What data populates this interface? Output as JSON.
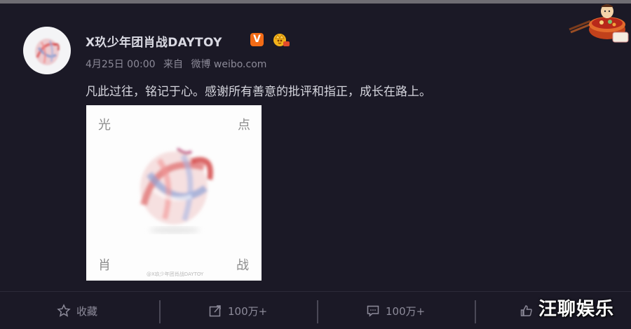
{
  "post": {
    "username": "X玖少年团肖战DAYTOY",
    "verified_badge": "V",
    "date": "4月25日 00:00",
    "source_prefix": "来自",
    "source": "微博 weibo.com",
    "text": "凡此过往，铭记于心。感谢所有善意的批评和指正，成长在路上。",
    "poster": {
      "top_left": "光",
      "top_right": "点",
      "bottom_left": "肖",
      "bottom_right": "战",
      "watermark": "@X玖少年团肖战DAYTOY"
    }
  },
  "actions": [
    {
      "label": "收藏",
      "icon": "star-icon"
    },
    {
      "label": "100万+",
      "icon": "share-icon"
    },
    {
      "label": "100万+",
      "icon": "comment-icon"
    },
    {
      "label": "",
      "icon": "like-icon"
    }
  ],
  "overlay_brand": "汪聊娱乐",
  "colors": {
    "background": "#1b1926",
    "accent_badge": "#f36b16",
    "text": "#d6d6de",
    "meta": "#8c8a98"
  }
}
